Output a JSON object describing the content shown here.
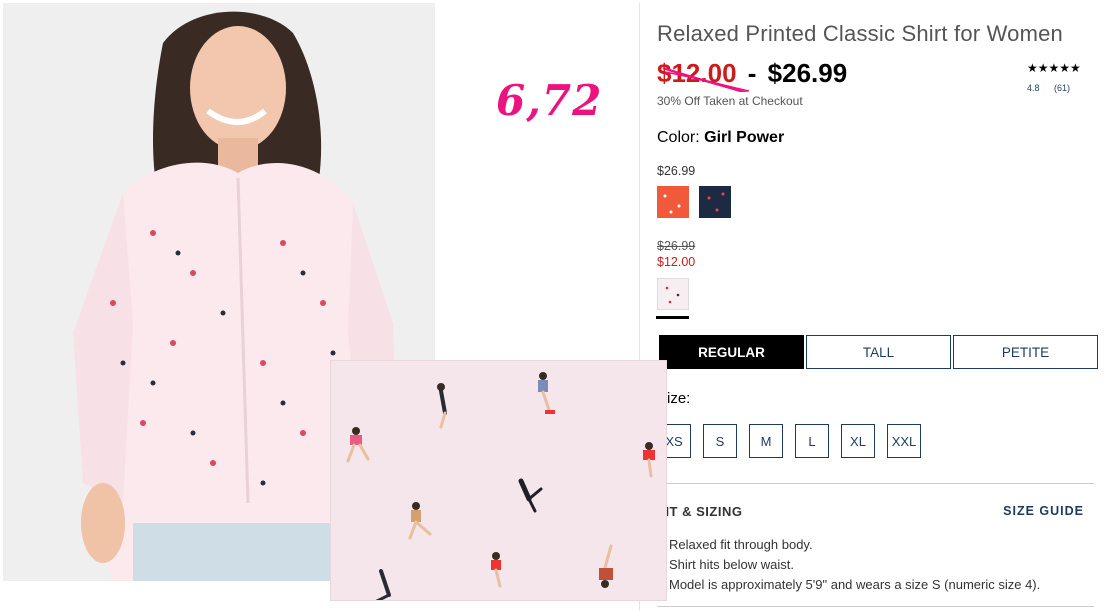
{
  "annotation": "6,72",
  "product": {
    "title": "Relaxed Printed Classic Shirt for Women",
    "price_old": "$12.00",
    "price_sep": "-",
    "price_new": "$26.99",
    "promo": "30% Off Taken at Checkout",
    "rating": {
      "stars": "★★★★★",
      "score": "4.8",
      "count": "(61)"
    }
  },
  "color": {
    "label": "Color:",
    "selected": "Girl Power",
    "groups": [
      {
        "price": "$26.99",
        "swatches": [
          "orange-print",
          "navy-print"
        ]
      },
      {
        "price_old": "$26.99",
        "price_sale": "$12.00",
        "swatches": [
          "pink-print"
        ]
      }
    ]
  },
  "fit_tabs": [
    "REGULAR",
    "TALL",
    "PETITE"
  ],
  "size": {
    "label": "Size:",
    "options": [
      "XS",
      "S",
      "M",
      "L",
      "XL",
      "XXL"
    ]
  },
  "fit_section": {
    "heading": "FIT & SIZING",
    "guide_link": "SIZE GUIDE",
    "bullets": [
      "Relaxed fit through body.",
      "Shirt hits below waist.",
      "Model is approximately 5'9\" and wears a size S (numeric size 4)."
    ]
  },
  "colors": {
    "sale_red": "#cf1a1a",
    "navy": "#1d3b5e",
    "annotation_pink": "#ec1380"
  }
}
